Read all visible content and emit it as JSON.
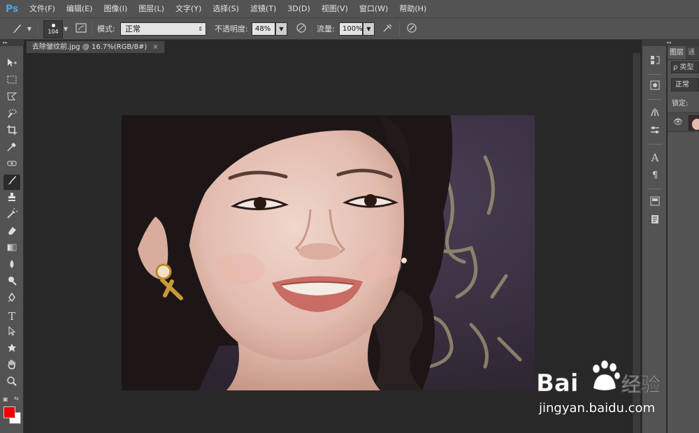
{
  "app": {
    "logo": "Ps",
    "menu": [
      "文件(F)",
      "编辑(E)",
      "图像(I)",
      "图层(L)",
      "文字(Y)",
      "选择(S)",
      "滤镜(T)",
      "3D(D)",
      "视图(V)",
      "窗口(W)",
      "帮助(H)"
    ]
  },
  "options": {
    "brush_size": "104",
    "mode_label": "模式:",
    "mode_value": "正常",
    "opacity_label": "不透明度:",
    "opacity_value": "48%",
    "flow_label": "流量:",
    "flow_value": "100%"
  },
  "document": {
    "tab_title": "去除皱纹前.jpg @ 16.7%(RGB/8#)",
    "close_glyph": "×"
  },
  "colors": {
    "foreground": "#ee0000",
    "background": "#ffffff"
  },
  "layers_panel": {
    "tab_layers": "图层",
    "tab_other": "通",
    "search_text": "ρ 类型",
    "blend_mode": "正常",
    "lock_label": "锁定:"
  },
  "watermark": {
    "url": "jingyan.baidu.com",
    "logo_text": "Bai",
    "logo_text2": "经验"
  }
}
